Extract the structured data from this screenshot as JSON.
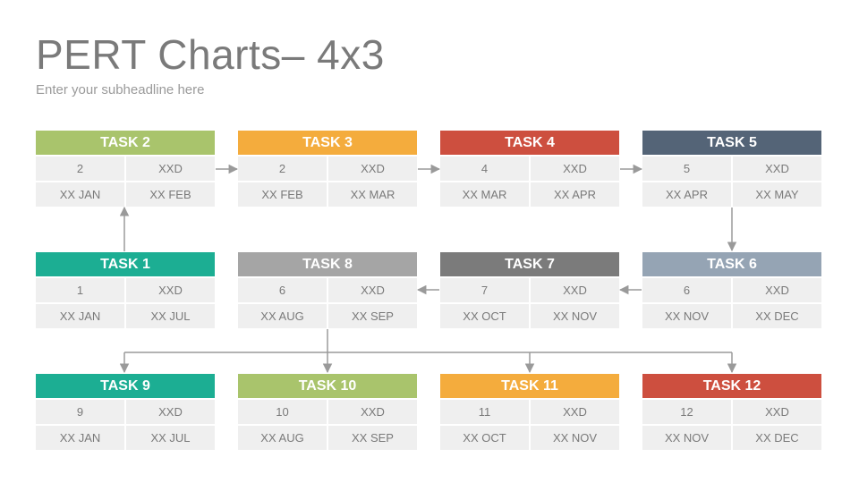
{
  "header": {
    "title": "PERT Charts– 4x3",
    "subtitle": "Enter your subheadline here"
  },
  "colors": {
    "green": "#a9c46c",
    "orange": "#f4ac3d",
    "red": "#cd4f3f",
    "navy": "#546477",
    "teal": "#1cae93",
    "gray": "#a5a5a5",
    "dark_gray": "#7b7b7b",
    "blue_gray": "#95a4b4",
    "cell_bg": "#efefef",
    "connector": "#9a9a9a"
  },
  "tasks": [
    {
      "title": "TASK 1",
      "number": "1",
      "duration": "XXD",
      "start": "XX JAN",
      "end": "XX JUL",
      "color": "teal"
    },
    {
      "title": "TASK 2",
      "number": "2",
      "duration": "XXD",
      "start": "XX JAN",
      "end": "XX FEB",
      "color": "green"
    },
    {
      "title": "TASK 3",
      "number": "2",
      "duration": "XXD",
      "start": "XX FEB",
      "end": "XX MAR",
      "color": "orange"
    },
    {
      "title": "TASK 4",
      "number": "4",
      "duration": "XXD",
      "start": "XX MAR",
      "end": "XX APR",
      "color": "red"
    },
    {
      "title": "TASK 5",
      "number": "5",
      "duration": "XXD",
      "start": "XX APR",
      "end": "XX MAY",
      "color": "navy"
    },
    {
      "title": "TASK 6",
      "number": "6",
      "duration": "XXD",
      "start": "XX NOV",
      "end": "XX DEC",
      "color": "blue_gray"
    },
    {
      "title": "TASK 7",
      "number": "7",
      "duration": "XXD",
      "start": "XX OCT",
      "end": "XX NOV",
      "color": "dark_gray"
    },
    {
      "title": "TASK 8",
      "number": "6",
      "duration": "XXD",
      "start": "XX AUG",
      "end": "XX SEP",
      "color": "gray"
    },
    {
      "title": "TASK 9",
      "number": "9",
      "duration": "XXD",
      "start": "XX JAN",
      "end": "XX JUL",
      "color": "teal"
    },
    {
      "title": "TASK 10",
      "number": "10",
      "duration": "XXD",
      "start": "XX AUG",
      "end": "XX SEP",
      "color": "green"
    },
    {
      "title": "TASK 11",
      "number": "11",
      "duration": "XXD",
      "start": "XX OCT",
      "end": "XX NOV",
      "color": "orange"
    },
    {
      "title": "TASK 12",
      "number": "12",
      "duration": "XXD",
      "start": "XX NOV",
      "end": "XX DEC",
      "color": "red"
    }
  ]
}
